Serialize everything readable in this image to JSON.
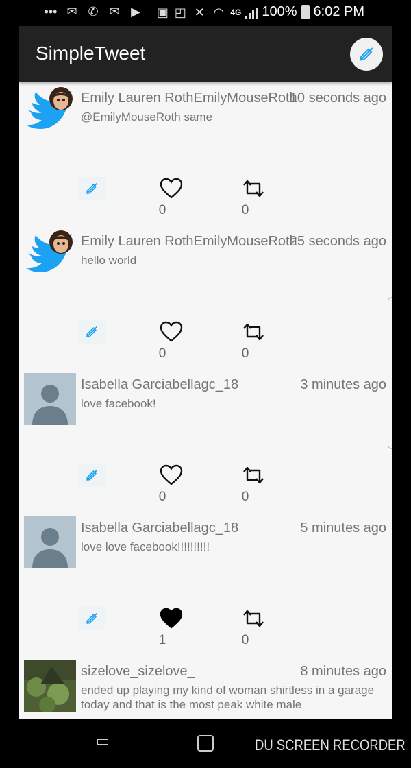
{
  "status_bar": {
    "battery_text": "100%",
    "time": "6:02 PM",
    "network": "4G"
  },
  "app": {
    "title": "SimpleTweet",
    "compose_icon": "compose-icon"
  },
  "tweets": [
    {
      "user": "Emily Lauren RothEmilyMouseRoth",
      "time": "10 seconds ago",
      "body": "@EmilyMouseRoth same",
      "avatar": "twitter-bird-avatar",
      "likes": "0",
      "retweets": "0",
      "liked": false
    },
    {
      "user": "Emily Lauren RothEmilyMouseRoth",
      "time": "25 seconds ago",
      "body": "hello world",
      "avatar": "twitter-bird-avatar",
      "likes": "0",
      "retweets": "0",
      "liked": false
    },
    {
      "user": "Isabella Garciabellagc_18",
      "time": "3 minutes ago",
      "body": "love facebook!",
      "avatar": "default-avatar",
      "likes": "0",
      "retweets": "0",
      "liked": false
    },
    {
      "user": "Isabella Garciabellagc_18",
      "time": "5 minutes ago",
      "body": "love love facebook!!!!!!!!!!",
      "avatar": "default-avatar",
      "likes": "1",
      "retweets": "0",
      "liked": true
    },
    {
      "user": "sizelove_sizelove_",
      "time": "8 minutes ago",
      "body": "ended up playing my kind of woman shirtless in a garage today and that is the most peak white male",
      "avatar": "photo-avatar",
      "likes": "",
      "retweets": "",
      "liked": false
    }
  ],
  "navigation": {
    "recorder_label": "DU SCREEN RECORDER"
  },
  "colors": {
    "toolbar": "#222222",
    "background": "#f6f6f6",
    "twitter_blue": "#1da1f2",
    "muted_text": "#757575"
  }
}
